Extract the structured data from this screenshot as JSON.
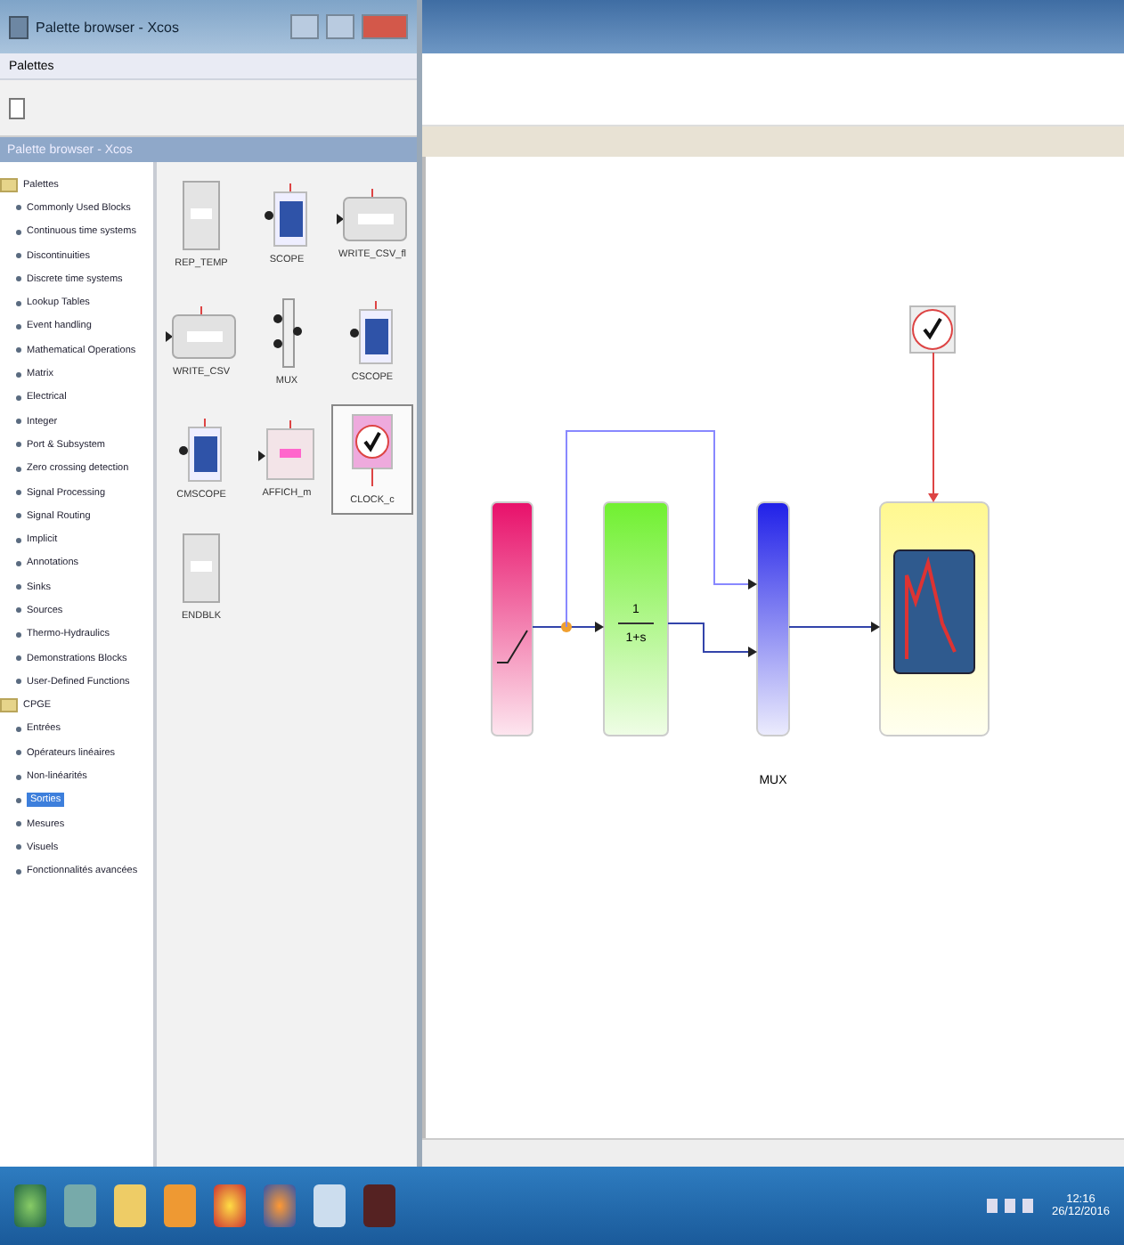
{
  "palette_window": {
    "title": "Palette browser - Xcos",
    "menu": [
      "Palettes"
    ],
    "header": "Palette browser - Xcos",
    "tree": [
      {
        "label": "Palettes",
        "children": [
          {
            "label": "Commonly Used Blocks",
            "selected": false
          },
          {
            "label": "Continuous time systems",
            "selected": false
          },
          {
            "label": "Discontinuities",
            "selected": false
          },
          {
            "label": "Discrete time systems",
            "selected": false
          },
          {
            "label": "Lookup Tables",
            "selected": false
          },
          {
            "label": "Event handling",
            "selected": false
          },
          {
            "label": "Mathematical Operations",
            "selected": false
          },
          {
            "label": "Matrix",
            "selected": false
          },
          {
            "label": "Electrical",
            "selected": false
          },
          {
            "label": "Integer",
            "selected": false
          },
          {
            "label": "Port & Subsystem",
            "selected": false
          },
          {
            "label": "Zero crossing detection",
            "selected": false
          },
          {
            "label": "Signal Processing",
            "selected": false
          },
          {
            "label": "Signal Routing",
            "selected": false
          },
          {
            "label": "Implicit",
            "selected": false
          },
          {
            "label": "Annotations",
            "selected": false
          },
          {
            "label": "Sinks",
            "selected": false
          },
          {
            "label": "Sources",
            "selected": false
          },
          {
            "label": "Thermo-Hydraulics",
            "selected": false
          },
          {
            "label": "Demonstrations Blocks",
            "selected": false
          },
          {
            "label": "User-Defined Functions",
            "selected": false
          }
        ]
      },
      {
        "label": "CPGE",
        "children": [
          {
            "label": "Entrées",
            "selected": false
          },
          {
            "label": "Opérateurs linéaires",
            "selected": false
          },
          {
            "label": "Non-linéarités",
            "selected": false
          },
          {
            "label": "Sorties",
            "selected": true
          },
          {
            "label": "Mesures",
            "selected": false
          },
          {
            "label": "Visuels",
            "selected": false
          },
          {
            "label": "Fonctionnalités avancées",
            "selected": false
          }
        ]
      }
    ],
    "blocks": [
      {
        "label": "REP_TEMP",
        "kind": "box",
        "selected": false
      },
      {
        "label": "SCOPE",
        "kind": "scope",
        "selected": false
      },
      {
        "label": "WRITE_CSV_fl",
        "kind": "wide",
        "selected": false
      },
      {
        "label": "WRITE_CSV",
        "kind": "wide",
        "selected": false
      },
      {
        "label": "MUX",
        "kind": "mux",
        "selected": false
      },
      {
        "label": "CSCOPE",
        "kind": "scope",
        "selected": false
      },
      {
        "label": "CMSCOPE",
        "kind": "scope",
        "selected": false
      },
      {
        "label": "AFFICH_m",
        "kind": "display",
        "selected": false
      },
      {
        "label": "CLOCK_c",
        "kind": "clock",
        "selected": true
      },
      {
        "label": "ENDBLK",
        "kind": "box",
        "selected": false
      }
    ]
  },
  "diagram": {
    "numerator": "1",
    "denominator": "1+s",
    "mux_label": "MUX"
  },
  "taskbar": {
    "time": "12:16",
    "date": "26/12/2016"
  }
}
